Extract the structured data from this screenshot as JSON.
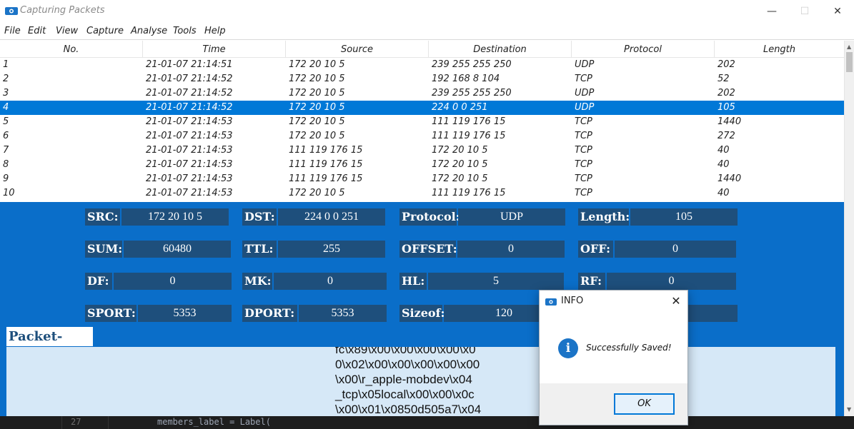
{
  "window": {
    "title": "Capturing Packets",
    "minimize_glyph": "—",
    "maximize_glyph": "☐",
    "close_glyph": "✕",
    "icon": "camera-icon",
    "accent": "#0078d7"
  },
  "menu": [
    "File",
    "Edit",
    "View",
    "Capture",
    "Analyse",
    "Tools",
    "Help"
  ],
  "table": {
    "columns": [
      "No.",
      "Time",
      "Source",
      "Destination",
      "Protocol",
      "Length"
    ],
    "selected_row": 4,
    "rows": [
      {
        "no": "1",
        "time": "21-01-07 21:14:51",
        "source": "172 20 10 5",
        "destination": "239 255 255 250",
        "protocol": "UDP",
        "length": "202"
      },
      {
        "no": "2",
        "time": "21-01-07 21:14:52",
        "source": "172 20 10 5",
        "destination": "192 168 8 104",
        "protocol": "TCP",
        "length": "52"
      },
      {
        "no": "3",
        "time": "21-01-07 21:14:52",
        "source": "172 20 10 5",
        "destination": "239 255 255 250",
        "protocol": "UDP",
        "length": "202"
      },
      {
        "no": "4",
        "time": "21-01-07 21:14:52",
        "source": "172 20 10 5",
        "destination": "224 0 0 251",
        "protocol": "UDP",
        "length": "105"
      },
      {
        "no": "5",
        "time": "21-01-07 21:14:53",
        "source": "172 20 10 5",
        "destination": "111 119 176 15",
        "protocol": "TCP",
        "length": "1440"
      },
      {
        "no": "6",
        "time": "21-01-07 21:14:53",
        "source": "172 20 10 5",
        "destination": "111 119 176 15",
        "protocol": "TCP",
        "length": "272"
      },
      {
        "no": "7",
        "time": "21-01-07 21:14:53",
        "source": "111 119 176 15",
        "destination": "172 20 10 5",
        "protocol": "TCP",
        "length": "40"
      },
      {
        "no": "8",
        "time": "21-01-07 21:14:53",
        "source": "111 119 176 15",
        "destination": "172 20 10 5",
        "protocol": "TCP",
        "length": "40"
      },
      {
        "no": "9",
        "time": "21-01-07 21:14:53",
        "source": "111 119 176 15",
        "destination": "172 20 10 5",
        "protocol": "TCP",
        "length": "1440"
      },
      {
        "no": "10",
        "time": "21-01-07 21:14:53",
        "source": "172 20 10 5",
        "destination": "111 119 176 15",
        "protocol": "TCP",
        "length": "40"
      }
    ]
  },
  "details": {
    "src": {
      "label": "SRC:",
      "value": "172 20 10 5"
    },
    "dst": {
      "label": "DST:",
      "value": "224 0 0 251"
    },
    "protocol": {
      "label": "Protocol:",
      "value": "UDP"
    },
    "length": {
      "label": "Length:",
      "value": "105"
    },
    "sum": {
      "label": "SUM:",
      "value": "60480"
    },
    "ttl": {
      "label": "TTL:",
      "value": "255"
    },
    "offset": {
      "label": "OFFSET:",
      "value": "0"
    },
    "off": {
      "label": "OFF:",
      "value": "0"
    },
    "df": {
      "label": "DF:",
      "value": "0"
    },
    "mk": {
      "label": "MK:",
      "value": "0"
    },
    "hl": {
      "label": "HL:",
      "value": "5"
    },
    "rf": {
      "label": "RF:",
      "value": "0"
    },
    "sport": {
      "label": "SPORT:",
      "value": "5353"
    },
    "dport": {
      "label": "DPORT:",
      "value": "5353"
    },
    "sizeof": {
      "label": "Sizeof:",
      "value": "120"
    }
  },
  "packet_data": {
    "title": "Packet-Data",
    "lines": [
      "\\x00\\x01\\x0850d505a7\\x04",
      "_tcp\\x05local\\x00\\x00\\x0c",
      "\\x00\\r_apple-mobdev\\x04",
      "0\\x02\\x00\\x00\\x00\\x00\\x00",
      "fc\\x89\\x00\\x00\\x00\\x00\\x0"
    ]
  },
  "editor": {
    "line_number": "27",
    "code": "members_label = Label("
  },
  "dialog": {
    "title": "INFO",
    "message": "Successfully Saved!",
    "ok_label": "OK",
    "close_glyph": "✕",
    "info_glyph": "i"
  }
}
